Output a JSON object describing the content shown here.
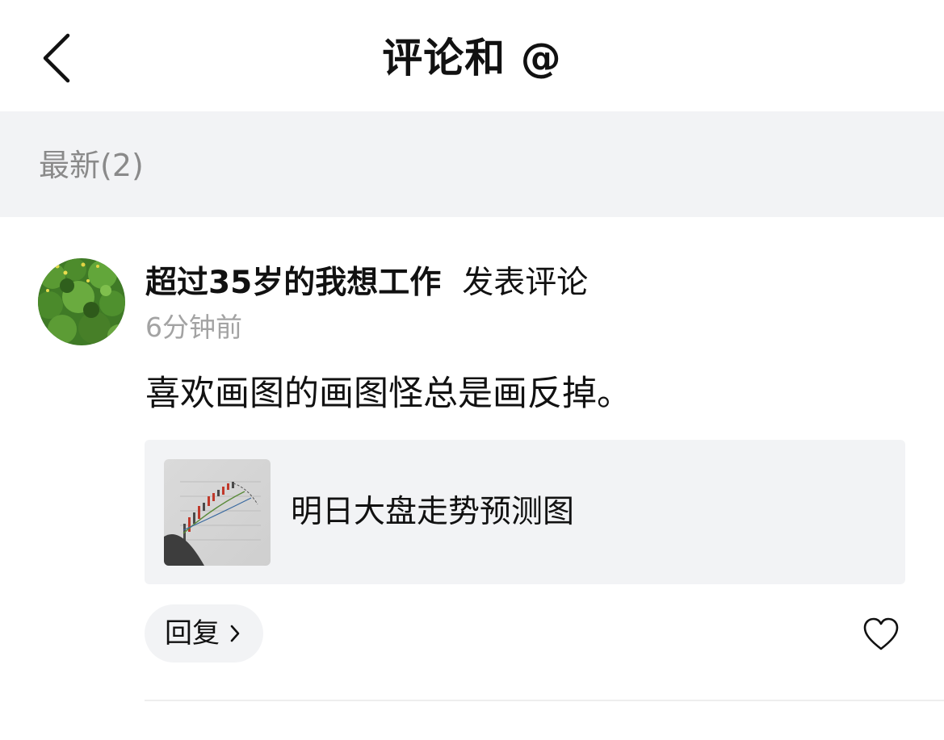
{
  "header": {
    "back_icon": "chevron-left-icon",
    "title": "评论和 @"
  },
  "section": {
    "label": "最新(2)"
  },
  "comment": {
    "avatar_icon": "green-foliage-photo",
    "username": "超过35岁的我想工作",
    "action": "发表评论",
    "timestamp": "6分钟前",
    "text": "喜欢画图的画图怪总是画反掉。",
    "quoted_post": {
      "thumbnail_icon": "stock-chart-sketch-photo",
      "title": "明日大盘走势预测图"
    },
    "reply_label": "回复",
    "reply_chevron_icon": "chevron-right-icon",
    "like_icon": "heart-outline-icon"
  },
  "colors": {
    "page_background": "#ffffff",
    "section_background": "#f2f3f5",
    "card_background": "#f2f3f5",
    "muted_text": "#a3a3a3",
    "section_text": "#8a8a8a",
    "primary_text": "#111111"
  }
}
